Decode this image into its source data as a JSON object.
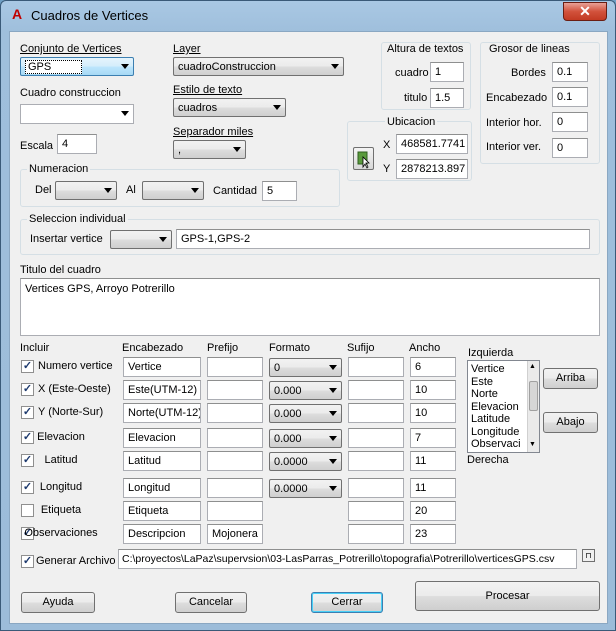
{
  "window": {
    "title": "Cuadros de Vertices",
    "close_glyph": "✕"
  },
  "conjunto": {
    "label": "Conjunto de Vertices",
    "value": "GPS"
  },
  "layer": {
    "label": "Layer",
    "value": "cuadroConstruccion"
  },
  "cuadro_construccion": {
    "label": "Cuadro construccion",
    "value": ""
  },
  "estilo": {
    "label": "Estilo de texto",
    "value": "cuadros"
  },
  "escala": {
    "label": "Escala",
    "value": "4"
  },
  "separador": {
    "label": "Separador miles",
    "value": ","
  },
  "altura": {
    "title": "Altura de textos",
    "cuadro_label": "cuadro",
    "cuadro_value": "1",
    "titulo_label": "titulo",
    "titulo_value": "1.5"
  },
  "ubicacion": {
    "title": "Ubicacion",
    "x_label": "X",
    "x_value": "468581.7741",
    "y_label": "Y",
    "y_value": "2878213.897"
  },
  "grosor": {
    "title": "Grosor de lineas",
    "bordes_label": "Bordes",
    "bordes_value": "0.1",
    "encabezado_label": "Encabezado",
    "encabezado_value": "0.1",
    "interior_hor_label": "Interior hor.",
    "interior_hor_value": "0",
    "interior_ver_label": "Interior ver.",
    "interior_ver_value": "0"
  },
  "numeracion": {
    "title": "Numeracion",
    "del_label": "Del",
    "al_label": "Al",
    "cantidad_label": "Cantidad",
    "cantidad_value": "5"
  },
  "seleccion": {
    "title": "Seleccion individual",
    "insertar_label": "Insertar vertice",
    "vertices_value": "GPS-1,GPS-2"
  },
  "titulo_cuadro": {
    "label": "Titulo del cuadro",
    "value": "Vertices GPS, Arroyo Potrerillo"
  },
  "columns": {
    "incluir": "Incluir",
    "encabezado": "Encabezado",
    "prefijo": "Prefijo",
    "formato": "Formato",
    "sufijo": "Sufijo",
    "ancho": "Ancho"
  },
  "rows": [
    {
      "label": "Numero vertice",
      "checked": true,
      "encabezado": "Vertice",
      "prefijo": "",
      "formato": "0",
      "sufijo": "",
      "ancho": "6"
    },
    {
      "label": "X (Este-Oeste)",
      "checked": true,
      "encabezado": "Este(UTM-12)",
      "prefijo": "",
      "formato": "0.000",
      "sufijo": "",
      "ancho": "10"
    },
    {
      "label": "Y (Norte-Sur)",
      "checked": true,
      "encabezado": "Norte(UTM-12)",
      "prefijo": "",
      "formato": "0.000",
      "sufijo": "",
      "ancho": "10"
    },
    {
      "label": "Elevacion",
      "checked": true,
      "encabezado": "Elevacion",
      "prefijo": "",
      "formato": "0.000",
      "sufijo": "",
      "ancho": "7"
    },
    {
      "label": "Latitud",
      "checked": true,
      "encabezado": "Latitud",
      "prefijo": "",
      "formato": "0.0000",
      "sufijo": "",
      "ancho": "11"
    },
    {
      "label": "Longitud",
      "checked": true,
      "encabezado": "Longitud",
      "prefijo": "",
      "formato": "0.0000",
      "sufijo": "",
      "ancho": "11"
    },
    {
      "label": "Etiqueta",
      "checked": false,
      "encabezado": "Etiqueta",
      "prefijo": "",
      "formato": "",
      "sufijo": "",
      "ancho": "20"
    },
    {
      "label": "Observaciones",
      "checked": true,
      "encabezado": "Descripcion",
      "prefijo": "Mojonera",
      "formato": "",
      "sufijo": "",
      "ancho": "23"
    }
  ],
  "order": {
    "izquierda": "Izquierda",
    "derecha": "Derecha",
    "items": [
      "Vertice",
      "Este",
      "Norte",
      "Elevacion",
      "Latitude",
      "Longitude",
      "Observaci"
    ],
    "arriba": "Arriba",
    "abajo": "Abajo"
  },
  "archivo": {
    "label": "Generar Archivo",
    "checked": true,
    "path": "C:\\proyectos\\LaPaz\\supervsion\\03-LasParras_Potrerillo\\topografia\\Potrerillo\\verticesGPS.csv"
  },
  "buttons": {
    "ayuda": "Ayuda",
    "cancelar": "Cancelar",
    "cerrar": "Cerrar",
    "procesar": "Procesar"
  },
  "colors": {
    "titlebar": "#a9c8e4",
    "close": "#c23a23",
    "face": "#f0f0f0"
  },
  "icons": {
    "app": "autocad-icon",
    "pick": "pick-point-icon",
    "browse": "browse-icon"
  }
}
